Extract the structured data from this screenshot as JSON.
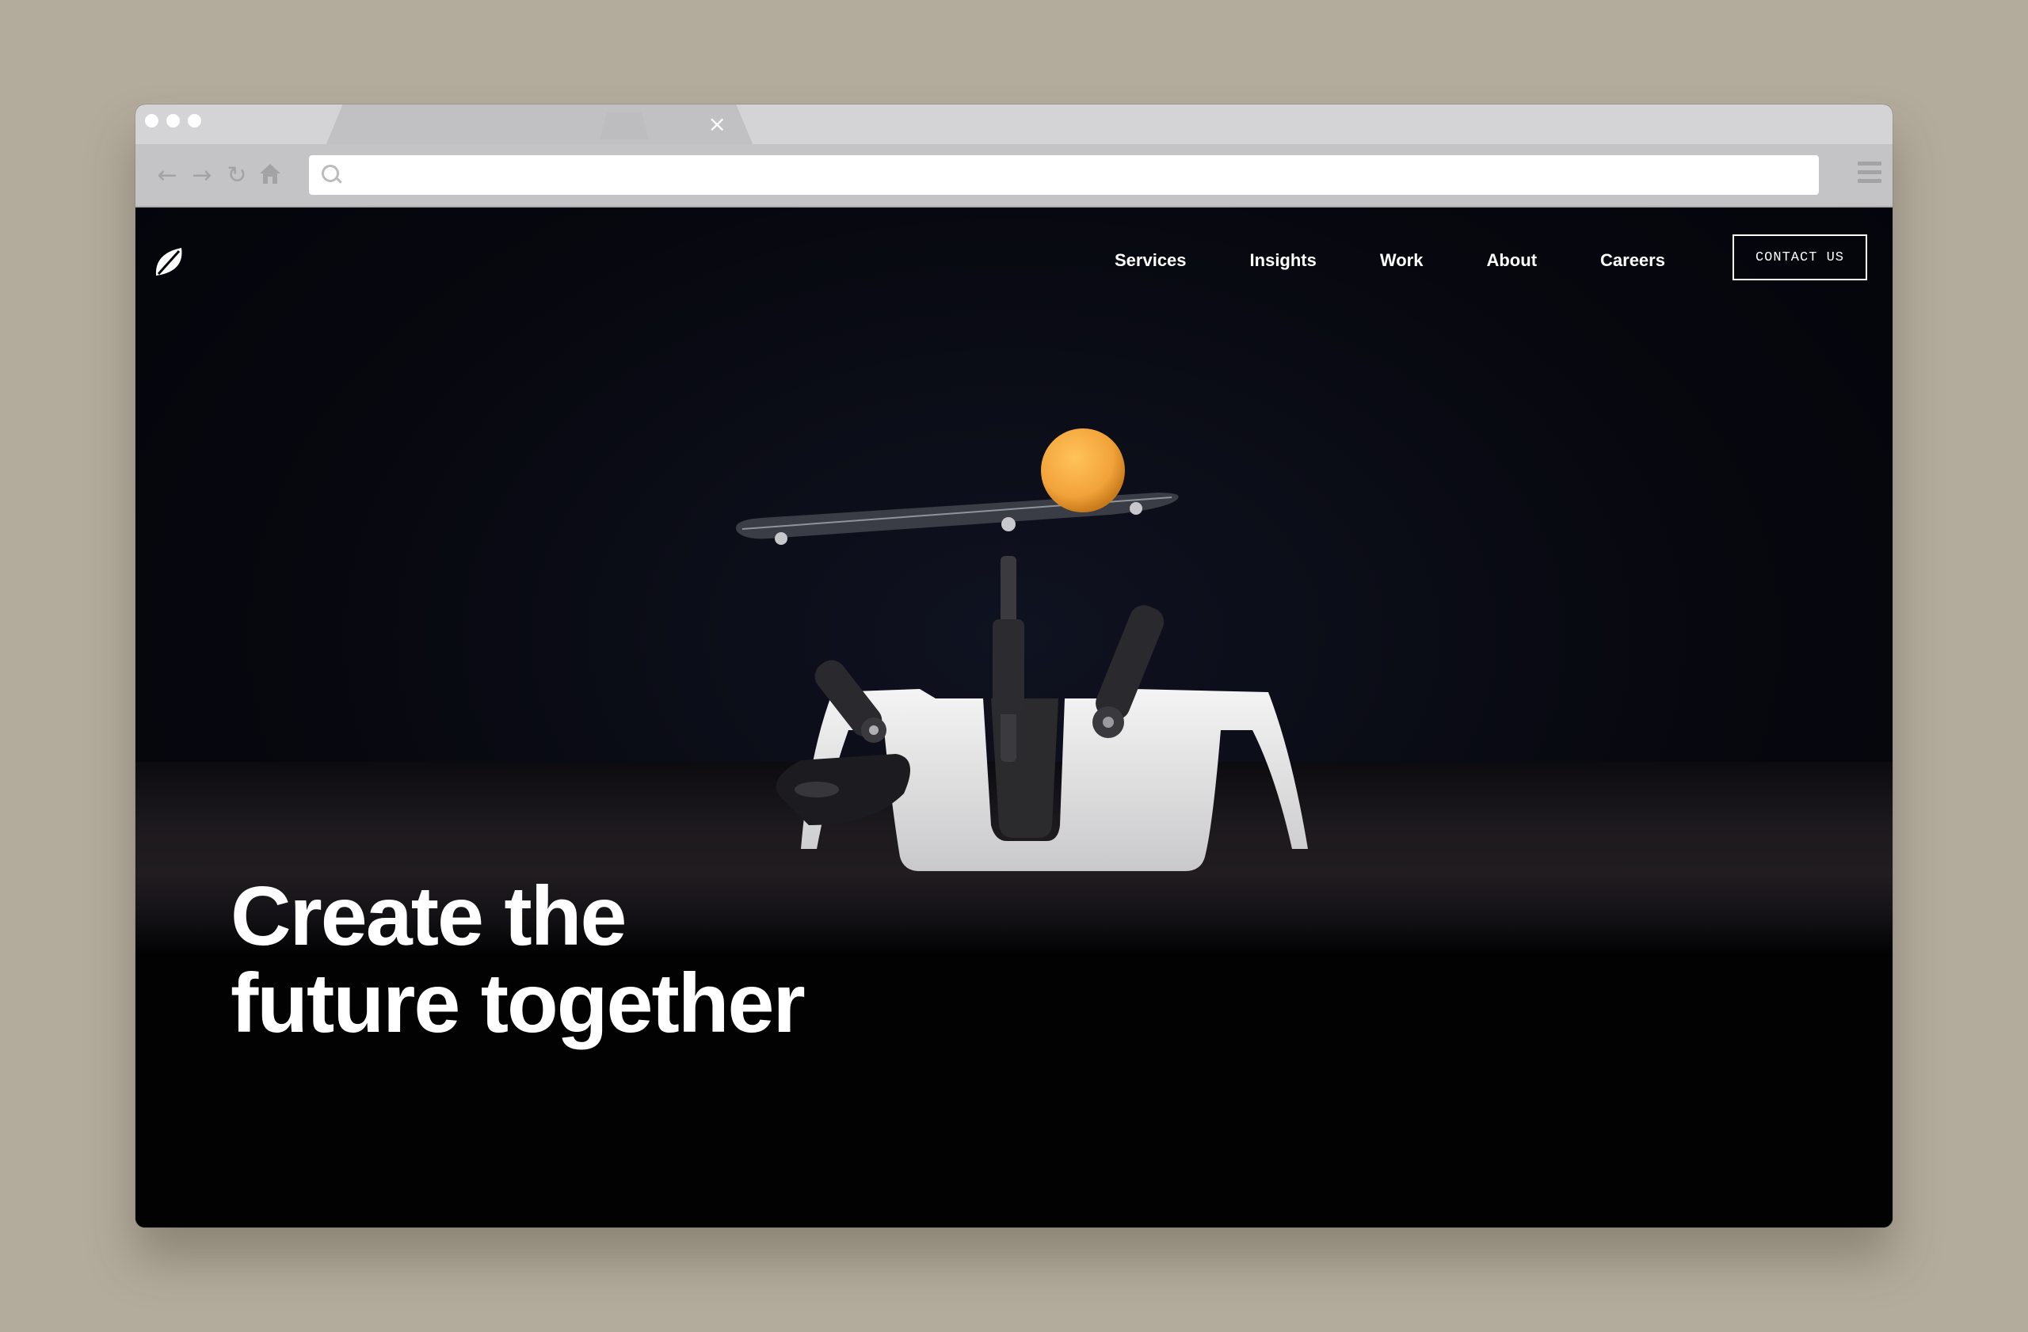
{
  "browser": {
    "tab_close_glyph": "×",
    "url_placeholder": "",
    "nav_icons": [
      "back-arrow-icon",
      "forward-arrow-icon",
      "reload-icon",
      "home-icon"
    ]
  },
  "site": {
    "nav": {
      "items": [
        "Services",
        "Insights",
        "Work",
        "About",
        "Careers"
      ],
      "contact_label": "CONTACT US"
    },
    "hero": {
      "headline_line1": "Create the",
      "headline_line2": "future together"
    },
    "colors": {
      "background": "#000000",
      "text": "#ffffff",
      "ball": "#f2a33a",
      "page_frame": "#b3ab9c"
    }
  }
}
